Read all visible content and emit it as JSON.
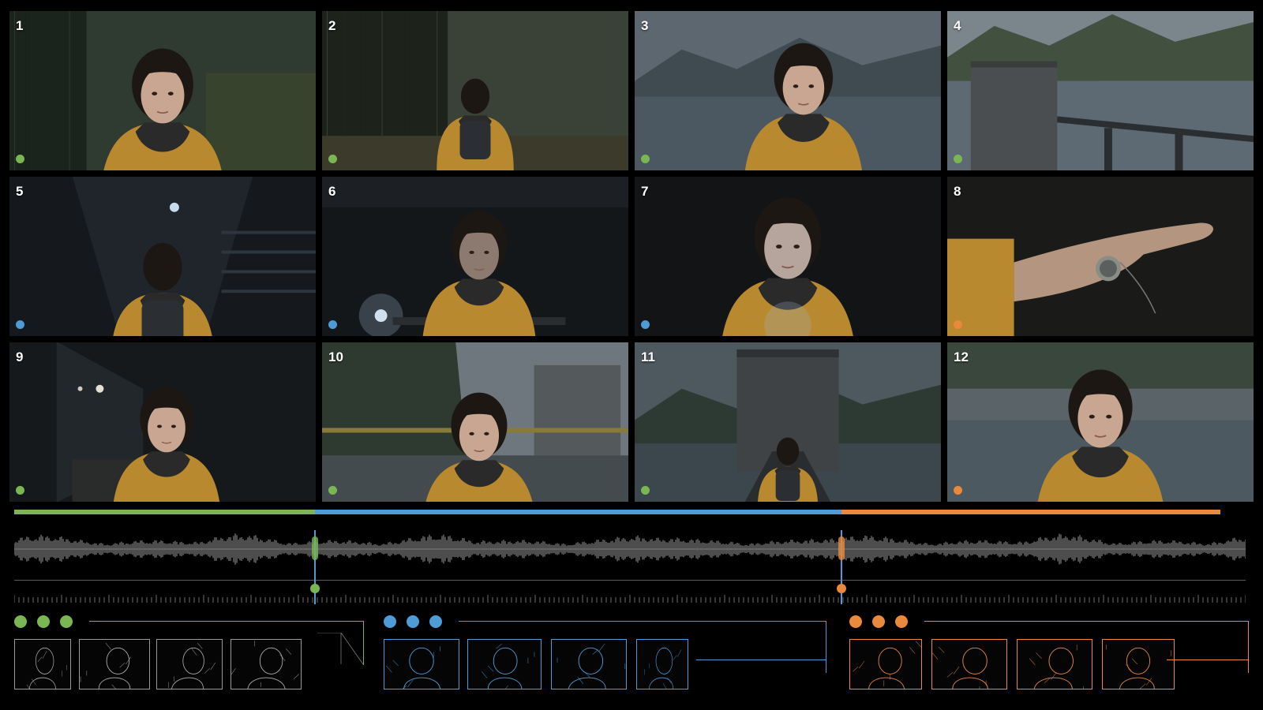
{
  "colors": {
    "act1": "#7bb654",
    "act2": "#4e9bd6",
    "act3": "#e8893c",
    "waveform": "#9a9a9a"
  },
  "shots": [
    {
      "number": "1",
      "act": "act1",
      "scene": "forest-closeup"
    },
    {
      "number": "2",
      "act": "act1",
      "scene": "forest-walk"
    },
    {
      "number": "3",
      "act": "act1",
      "scene": "lake-profile"
    },
    {
      "number": "4",
      "act": "act1",
      "scene": "dam-tower"
    },
    {
      "number": "5",
      "act": "act2",
      "scene": "corridor-back"
    },
    {
      "number": "6",
      "act": "act2",
      "scene": "flashlight-desk"
    },
    {
      "number": "7",
      "act": "act2",
      "scene": "lit-face"
    },
    {
      "number": "8",
      "act": "act3",
      "scene": "hand-compass"
    },
    {
      "number": "9",
      "act": "act1",
      "scene": "corridor-look"
    },
    {
      "number": "10",
      "act": "act1",
      "scene": "bridge-railing"
    },
    {
      "number": "11",
      "act": "act1",
      "scene": "tower-walkway"
    },
    {
      "number": "12",
      "act": "act3",
      "scene": "final-smile"
    }
  ],
  "acts": [
    {
      "id": "act1",
      "dots": 3,
      "thumbnails": 4
    },
    {
      "id": "act2",
      "dots": 3,
      "thumbnails": 4
    },
    {
      "id": "act3",
      "dots": 3,
      "thumbnails": 4
    }
  ],
  "timeline": {
    "act_boundaries_fraction": [
      0.0,
      0.2445,
      0.6715,
      0.9795
    ],
    "markers_fraction": [
      0.2445,
      0.6715
    ]
  }
}
